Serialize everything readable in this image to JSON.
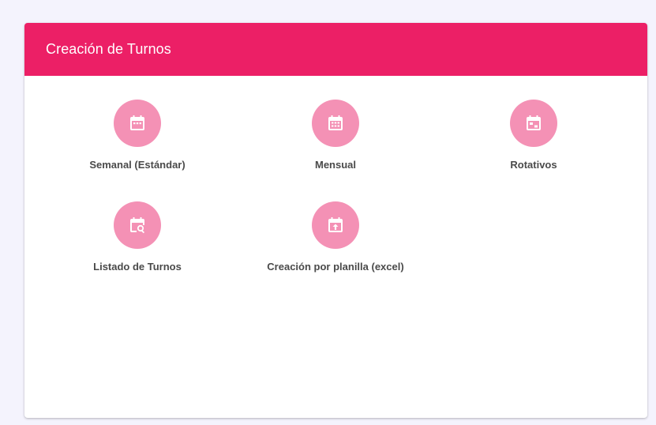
{
  "header": {
    "title": "Creación de Turnos"
  },
  "colors": {
    "header_bg": "#ec1f66",
    "icon_circle": "#f491b5",
    "label_text": "#4a4a4a",
    "page_bg": "#f4f3fd"
  },
  "options": [
    {
      "label": "Semanal (Estándar)",
      "icon": "calendar-week-icon"
    },
    {
      "label": "Mensual",
      "icon": "calendar-month-icon"
    },
    {
      "label": "Rotativos",
      "icon": "calendar-rotate-icon"
    },
    {
      "label": "Listado de Turnos",
      "icon": "calendar-search-icon"
    },
    {
      "label": "Creación por planilla (excel)",
      "icon": "calendar-upload-icon"
    }
  ]
}
